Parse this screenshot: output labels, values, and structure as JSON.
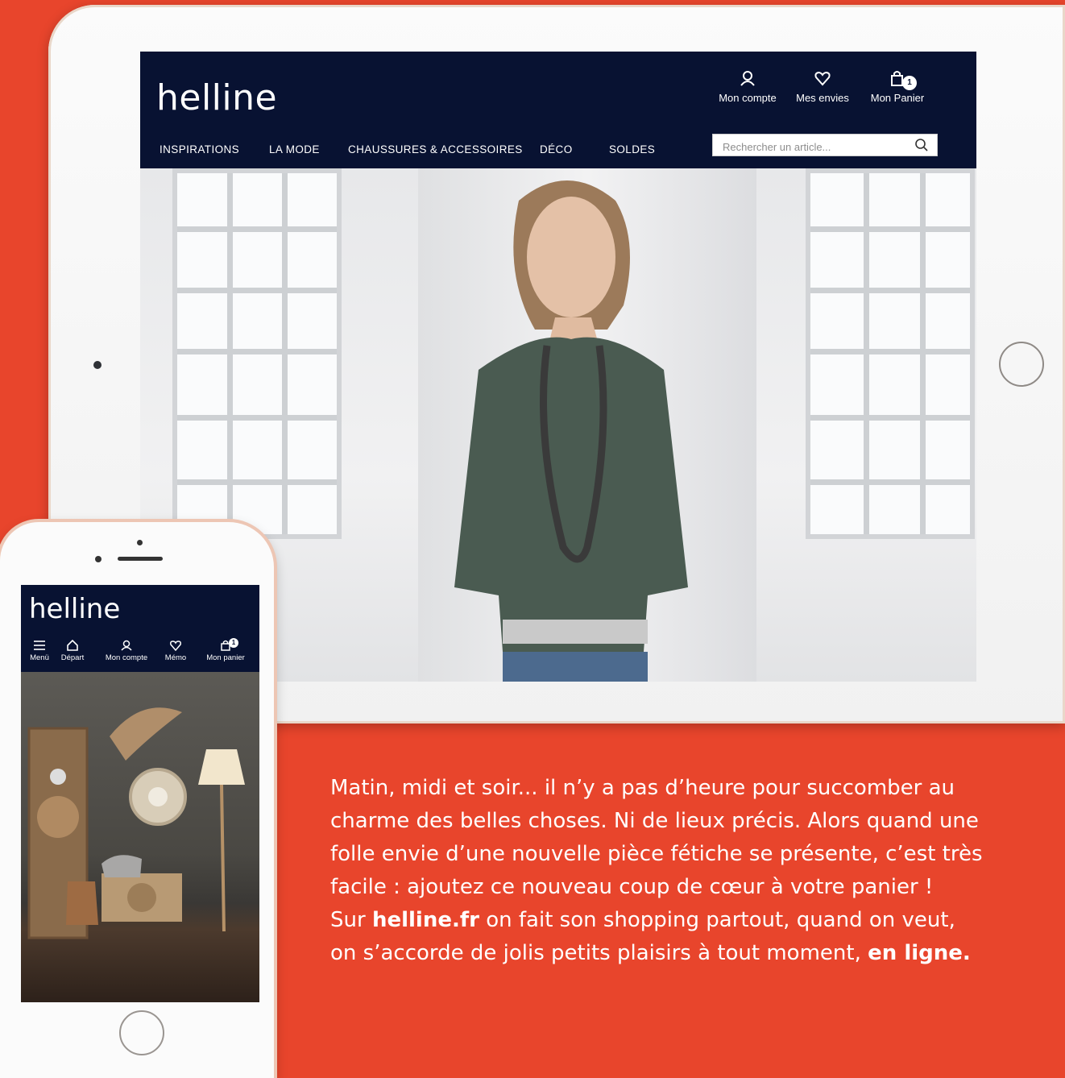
{
  "tablet_site": {
    "logo": "helline",
    "actions": [
      {
        "label": "Mon compte",
        "icon": "user-icon"
      },
      {
        "label": "Mes envies",
        "icon": "heart-icon"
      },
      {
        "label": "Mon Panier",
        "icon": "bag-icon",
        "badge": "1"
      }
    ],
    "nav": [
      "INSPIRATIONS",
      "LA MODE",
      "CHAUSSURES & ACCESSOIRES",
      "DÉCO",
      "SOLDES"
    ],
    "search_placeholder": "Rechercher un article..."
  },
  "phone_site": {
    "logo": "helline",
    "tabs": [
      {
        "label": "Menü",
        "icon": "menu-icon"
      },
      {
        "label": "Départ",
        "icon": "home-icon"
      },
      {
        "label": "Mon compte",
        "icon": "user-icon"
      },
      {
        "label": "Mémo",
        "icon": "heart-icon"
      },
      {
        "label": "Mon panier",
        "icon": "bag-icon",
        "badge": "1"
      }
    ]
  },
  "copy": {
    "line1": "Matin, midi et soir... il n’y a pas d’heure pour succomber au",
    "line2": "charme des belles choses. Ni de lieux précis. Alors quand une",
    "line3": "folle envie d’une nouvelle pièce fétiche se présente, c’est très",
    "line4": "facile : ajoutez ce nouveau coup de cœur à votre panier !",
    "line5_pre": "Sur ",
    "line5_bold": "helline.fr",
    "line5_post": " on fait son shopping partout, quand on veut,",
    "line6_pre": "on s’accorde de jolis petits plaisirs à tout moment, ",
    "line6_bold": "en ligne."
  },
  "colors": {
    "background": "#e8452c",
    "header": "#081232"
  }
}
